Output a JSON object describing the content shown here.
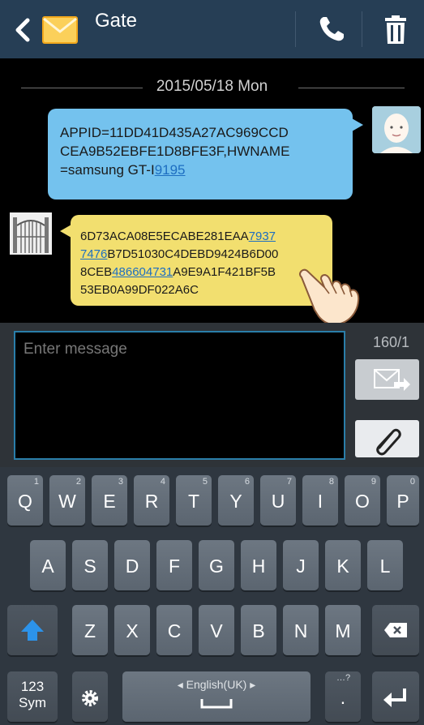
{
  "header": {
    "contact_name": "Gate",
    "back_icon": "back-arrow-icon",
    "contact_icon": "envelope-icon",
    "call_icon": "phone-icon",
    "delete_icon": "trash-icon"
  },
  "conversation": {
    "date": "2015/05/18 Mon",
    "outgoing": {
      "line1": "APPID=11DD41D435A27AC969CCD",
      "line2": "CEA9B52EBFE1D8BFE3F,HWNAME",
      "line3_text": "=samsung GT-I",
      "line3_link": "9195"
    },
    "incoming": {
      "l1_text": "6D73ACA08E5ECABE281EAA",
      "l1_link": "7937",
      "l2_link": "7476",
      "l2_text": "B7D51030C4DEBD9424B6D00",
      "l3_text1": "8CEB",
      "l3_link": "486604731",
      "l3_text2": "A9E9A1F421BF5B",
      "l4_text": "53EB0A99DF022A6C"
    }
  },
  "compose": {
    "placeholder": "Enter message",
    "counter": "160/1",
    "send_icon": "send-message-icon",
    "attach_icon": "paperclip-icon"
  },
  "keyboard": {
    "row1": [
      {
        "label": "Q",
        "num": "1"
      },
      {
        "label": "W",
        "num": "2"
      },
      {
        "label": "E",
        "num": "3"
      },
      {
        "label": "R",
        "num": "4"
      },
      {
        "label": "T",
        "num": "5"
      },
      {
        "label": "Y",
        "num": "6"
      },
      {
        "label": "U",
        "num": "7"
      },
      {
        "label": "I",
        "num": "8"
      },
      {
        "label": "O",
        "num": "9"
      },
      {
        "label": "P",
        "num": "0"
      }
    ],
    "row2": [
      "A",
      "S",
      "D",
      "F",
      "G",
      "H",
      "J",
      "K",
      "L"
    ],
    "row3": [
      "Z",
      "X",
      "C",
      "V",
      "B",
      "N",
      "M"
    ],
    "sym_line1": "123",
    "sym_line2": "Sym",
    "language": "English(UK)",
    "period": ".",
    "period_hint": "…?"
  }
}
